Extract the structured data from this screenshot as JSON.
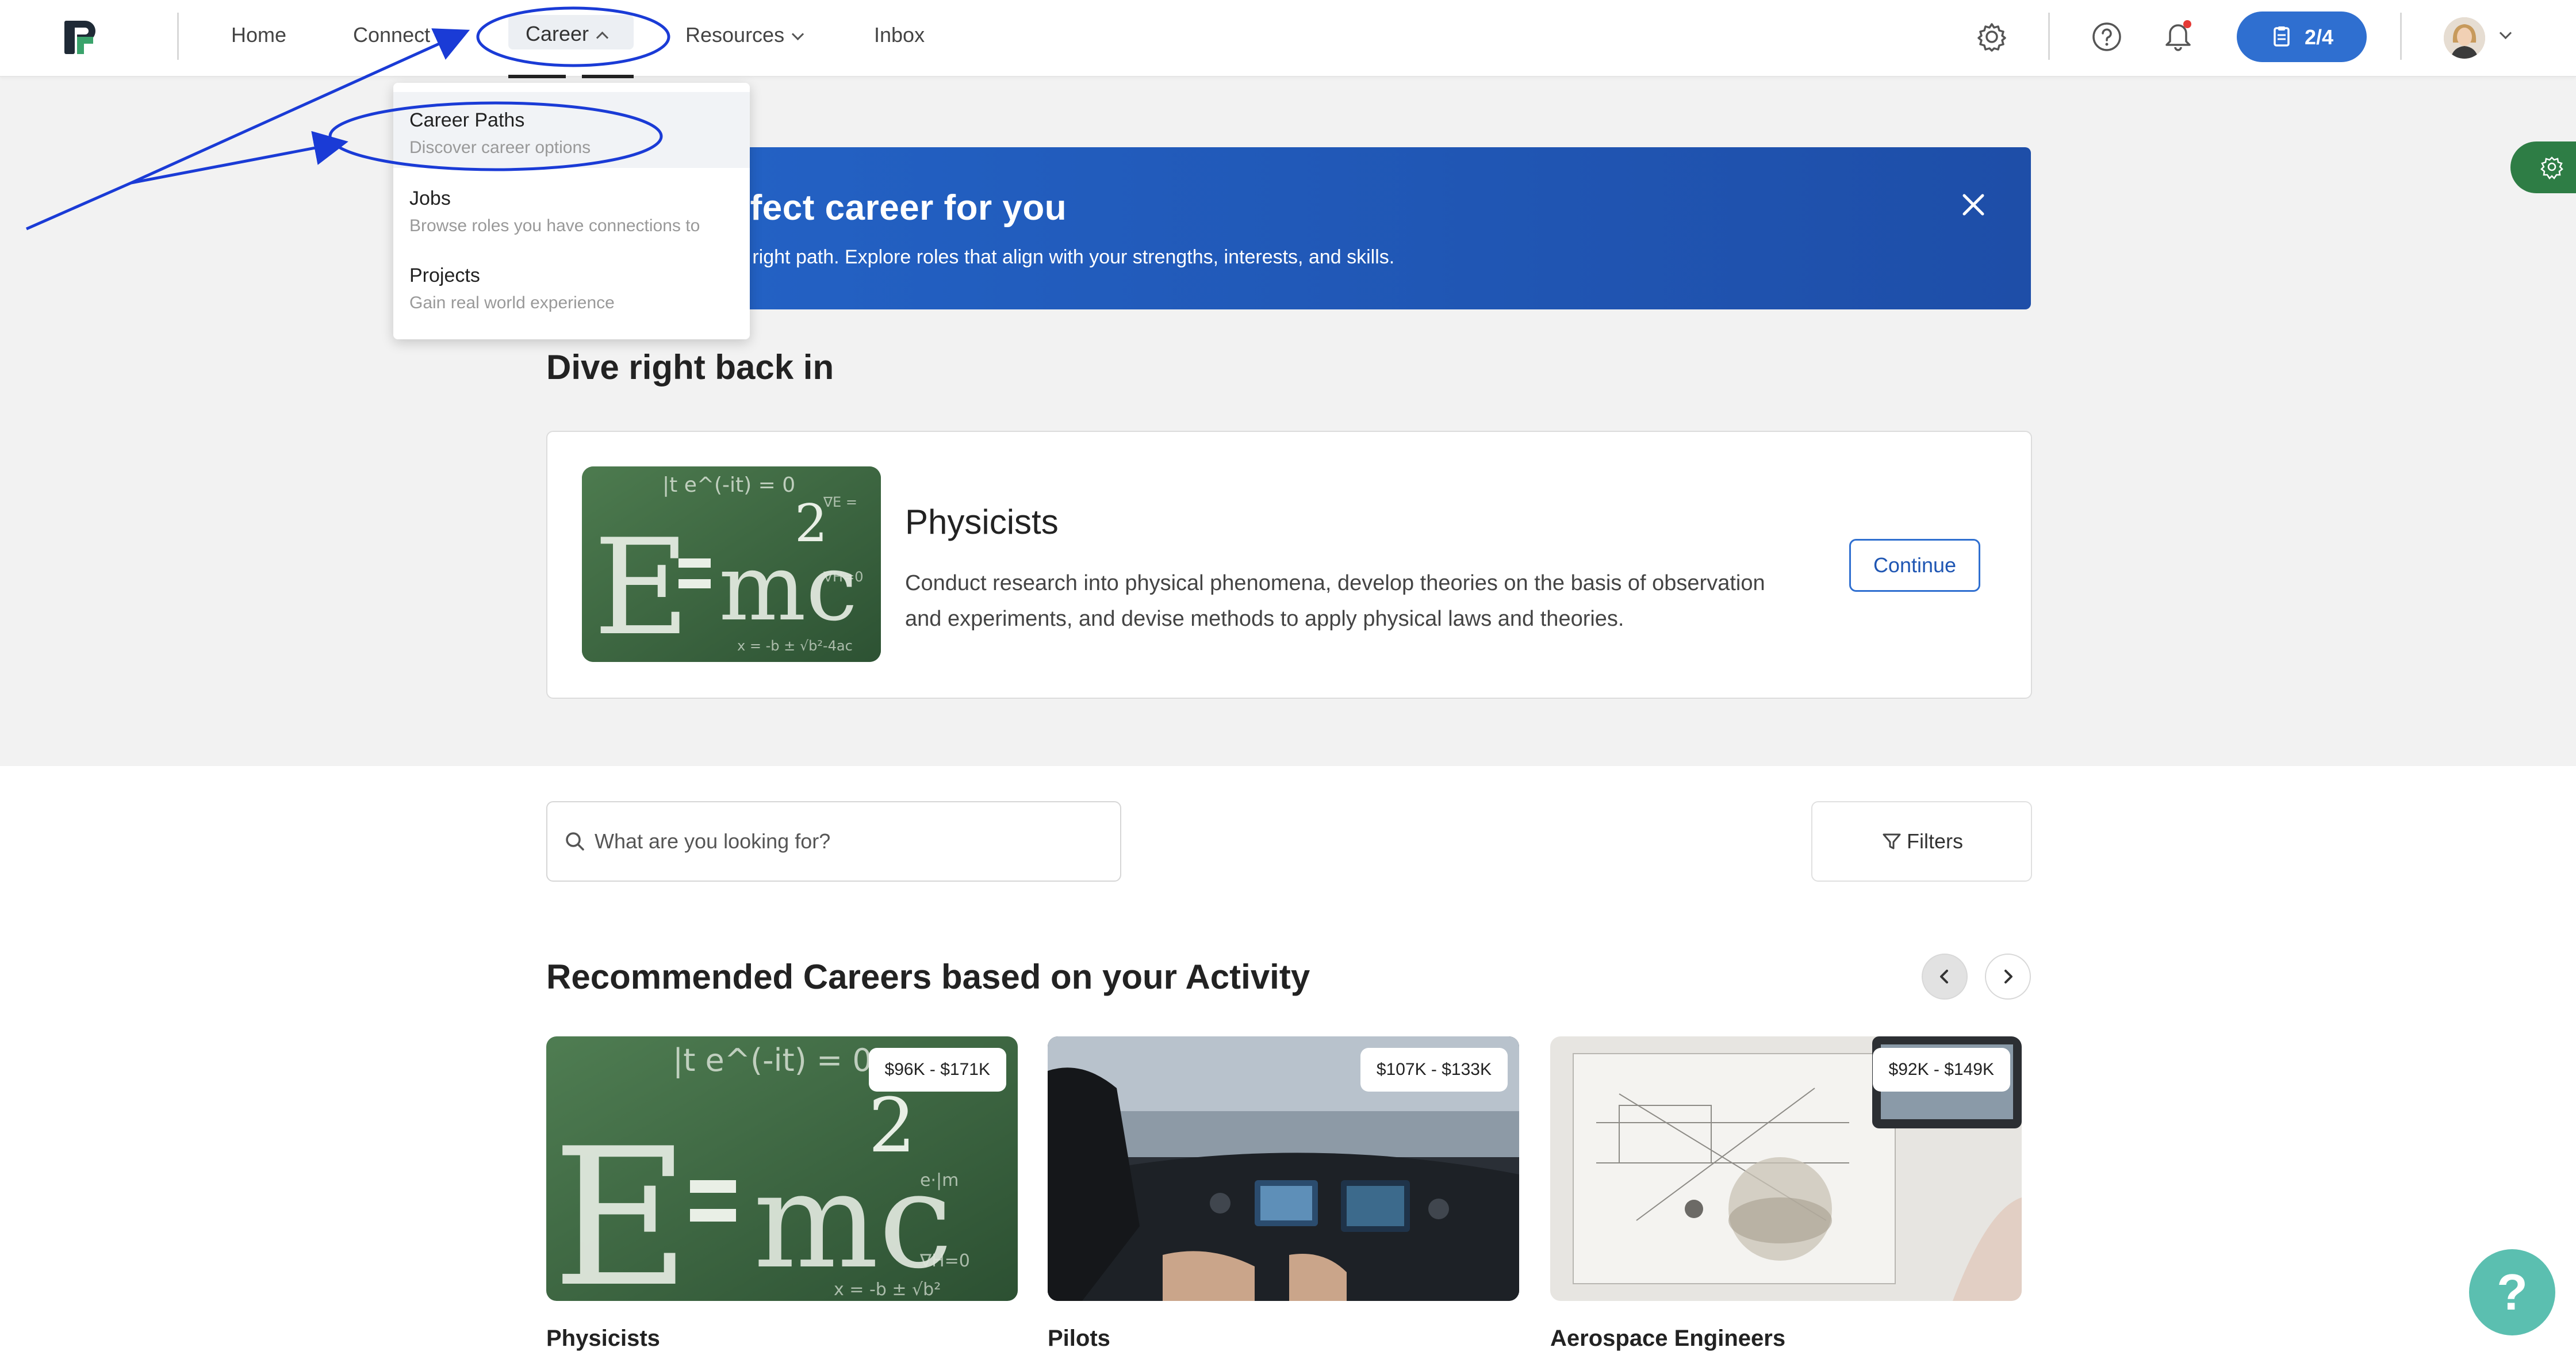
{
  "nav": {
    "home": "Home",
    "connect": "Connect",
    "career": "Career",
    "resources": "Resources",
    "inbox": "Inbox",
    "progress": "2/4"
  },
  "career_menu": [
    {
      "label": "Career Paths",
      "sub": "Discover career options"
    },
    {
      "label": "Jobs",
      "sub": "Browse roles you have connections to"
    },
    {
      "label": "Projects",
      "sub": "Gain real world experience"
    }
  ],
  "banner": {
    "title": "rfect career for you",
    "subtitle": "e right path. Explore roles that align with your strengths, interests, and skills."
  },
  "resume": {
    "heading": "Dive right back in",
    "title": "Physicists",
    "description": "Conduct research into physical phenomena, develop theories on the basis of observation and experiments, and devise methods to apply physical laws and theories.",
    "button": "Continue"
  },
  "search": {
    "placeholder": "What are you looking for?",
    "filters_label": "Filters"
  },
  "recommended": {
    "heading": "Recommended Careers based on your Activity",
    "cards": [
      {
        "name": "Physicists",
        "salary": "$96K - $171K"
      },
      {
        "name": "Pilots",
        "salary": "$107K - $133K"
      },
      {
        "name": "Aerospace Engineers",
        "salary": "$92K - $149K"
      }
    ]
  },
  "help_label": "?",
  "colors": {
    "primary": "#2f6fd0",
    "banner_start": "#2464c8",
    "banner_end": "#1e4ea8",
    "annotation": "#1a3bd6",
    "side_tab": "#2e7d45",
    "help_fab": "#5bbfb0"
  }
}
